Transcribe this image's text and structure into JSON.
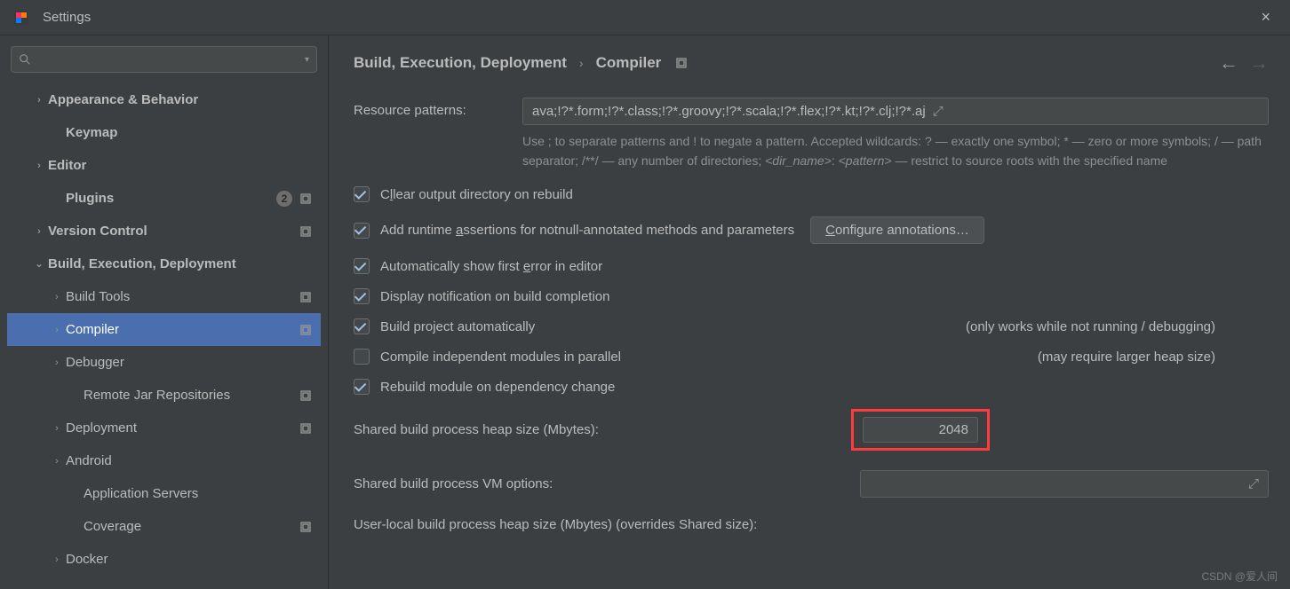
{
  "title": "Settings",
  "close_icon": "×",
  "search": {
    "placeholder": ""
  },
  "sidebar": {
    "items": [
      {
        "label": "Appearance & Behavior",
        "chev": "›",
        "bold": true,
        "indent": 1
      },
      {
        "label": "Keymap",
        "chev": "",
        "bold": true,
        "indent": 2
      },
      {
        "label": "Editor",
        "chev": "›",
        "bold": true,
        "indent": 1
      },
      {
        "label": "Plugins",
        "chev": "",
        "bold": true,
        "indent": 2,
        "badge": "2",
        "proj": true
      },
      {
        "label": "Version Control",
        "chev": "›",
        "bold": true,
        "indent": 1,
        "proj": true
      },
      {
        "label": "Build, Execution, Deployment",
        "chev": "⌄",
        "bold": true,
        "indent": 1
      },
      {
        "label": "Build Tools",
        "chev": "›",
        "bold": false,
        "indent": 2,
        "proj": true
      },
      {
        "label": "Compiler",
        "chev": "›",
        "bold": false,
        "indent": 2,
        "proj": true,
        "selected": true
      },
      {
        "label": "Debugger",
        "chev": "›",
        "bold": false,
        "indent": 2
      },
      {
        "label": "Remote Jar Repositories",
        "chev": "",
        "bold": false,
        "indent": 3,
        "proj": true
      },
      {
        "label": "Deployment",
        "chev": "›",
        "bold": false,
        "indent": 2,
        "proj": true
      },
      {
        "label": "Android",
        "chev": "›",
        "bold": false,
        "indent": 2
      },
      {
        "label": "Application Servers",
        "chev": "",
        "bold": false,
        "indent": 3
      },
      {
        "label": "Coverage",
        "chev": "",
        "bold": false,
        "indent": 3,
        "proj": true
      },
      {
        "label": "Docker",
        "chev": "›",
        "bold": false,
        "indent": 2
      }
    ]
  },
  "breadcrumb": {
    "a": "Build, Execution, Deployment",
    "b": "Compiler"
  },
  "resource": {
    "label": "Resource patterns:",
    "value": "ava;!?*.form;!?*.class;!?*.groovy;!?*.scala;!?*.flex;!?*.kt;!?*.clj;!?*.aj",
    "help_a": "Use ; to separate patterns and ! to negate a pattern. Accepted wildcards: ? — exactly one symbol; * — zero or more symbols; / — path separator; /**/ — any number of directories; ",
    "help_b": "<dir_name>",
    "help_c": ": ",
    "help_d": "<pattern>",
    "help_e": " — restrict to source roots with the specified name"
  },
  "checks": {
    "clear": "lear output directory on rebuild",
    "assert": "ssertions for notnull-annotated methods and parameters",
    "assert_pre": "Add runtime ",
    "configure": "onfigure annotations…",
    "auto_err": "rror in editor",
    "auto_err_pre": "Automatically show first ",
    "notif": "Display notification on build completion",
    "build_auto": "Build project automatically",
    "build_auto_note": "(only works while not running / debugging)",
    "parallel": "Compile independent modules in parallel",
    "parallel_note": "(may require larger heap size)",
    "rebuild_dep": "Rebuild module on dependency change"
  },
  "fields": {
    "heap_label": "Shared build process heap size (Mbytes):",
    "heap_value": "2048",
    "vm_label": "Shared build process VM options:",
    "vm_value": "",
    "user_heap_label": "User-local build process heap size (Mbytes) (overrides Shared size):"
  },
  "watermark": "CSDN @爱人间"
}
